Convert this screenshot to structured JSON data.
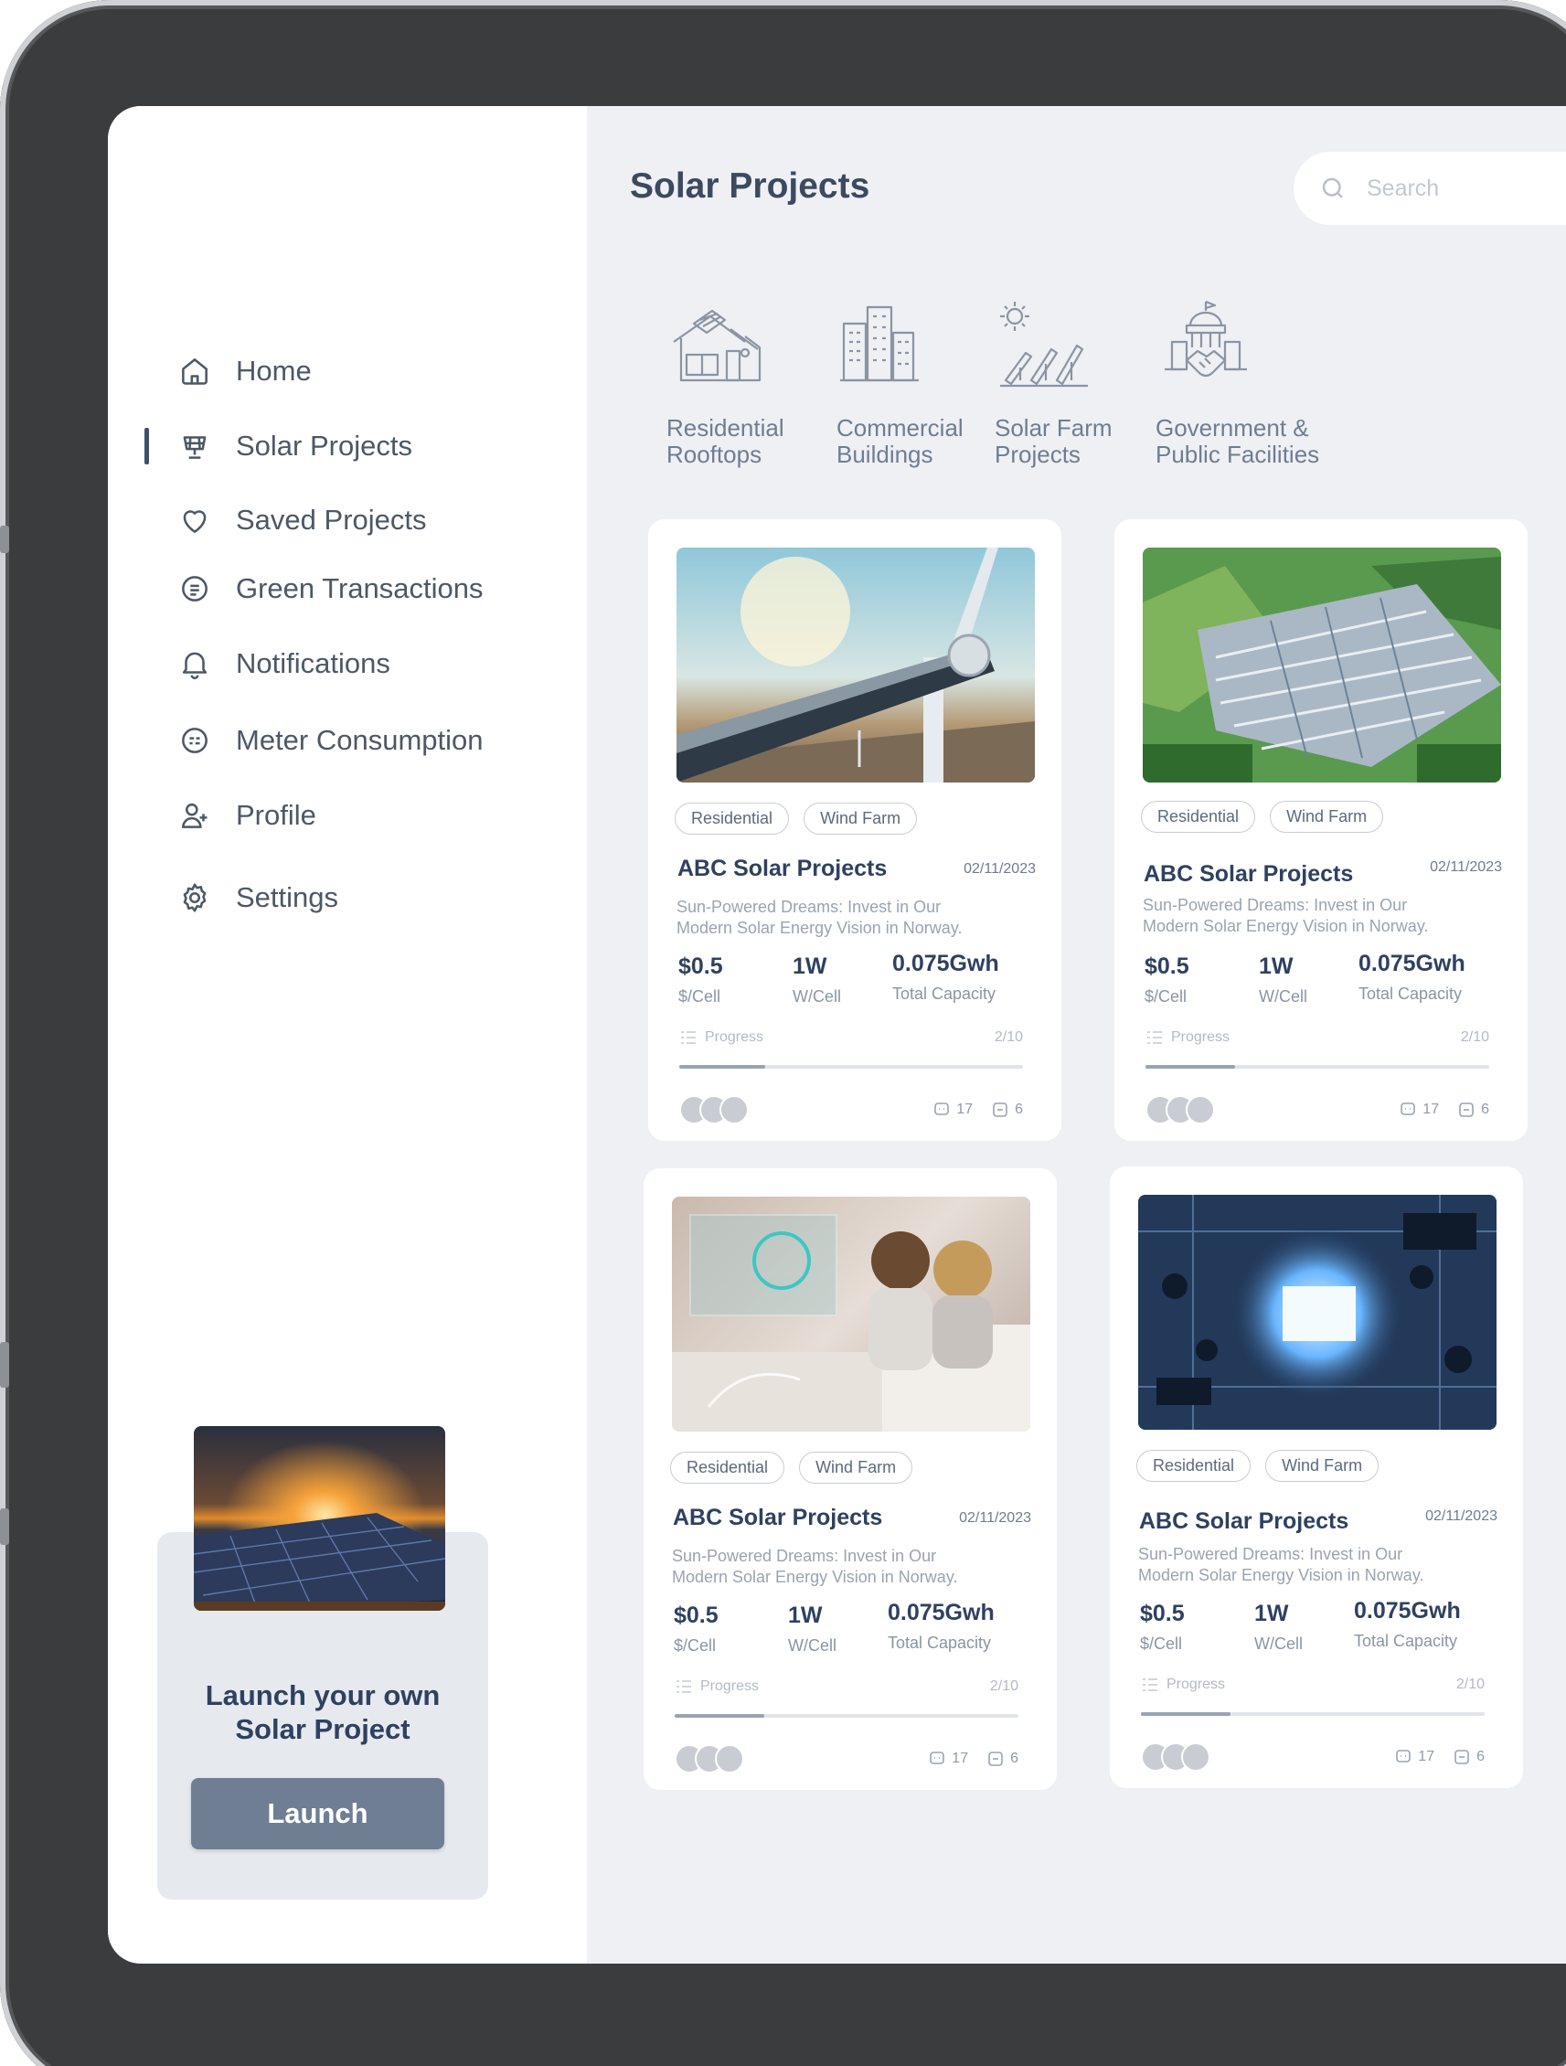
{
  "header": {
    "title": "Solar Projects",
    "search_placeholder": "Search"
  },
  "sidebar": {
    "items": [
      {
        "label": "Home",
        "icon": "home-icon"
      },
      {
        "label": "Solar Projects",
        "icon": "solar-panel-icon",
        "active": true
      },
      {
        "label": "Saved Projects",
        "icon": "heart-icon"
      },
      {
        "label": "Green Transactions",
        "icon": "receipt-icon"
      },
      {
        "label": "Notifications",
        "icon": "bell-icon"
      },
      {
        "label": "Meter Consumption",
        "icon": "meter-icon"
      },
      {
        "label": "Profile",
        "icon": "user-add-icon"
      },
      {
        "label": "Settings",
        "icon": "gear-icon"
      }
    ],
    "promo": {
      "title_line1": "Launch your own",
      "title_line2": "Solar Project",
      "button": "Launch"
    }
  },
  "categories": [
    {
      "line1": "Residential",
      "line2": "Rooftops",
      "icon": "house-solar-icon"
    },
    {
      "line1": "Commercial",
      "line2": "Buildings",
      "icon": "buildings-icon"
    },
    {
      "line1": "Solar Farm",
      "line2": "Projects",
      "icon": "solar-farm-icon"
    },
    {
      "line1": "Government &",
      "line2": "Public Facilities",
      "icon": "government-handshake-icon"
    }
  ],
  "cards": [
    {
      "image": "wind-turbine-image",
      "tags": [
        "Residential",
        "Wind Farm"
      ],
      "title": "ABC Solar Projects",
      "date": "02/11/2023",
      "desc1": "Sun-Powered Dreams: Invest in Our",
      "desc2": "Modern Solar Energy Vision in Norway.",
      "price": "$0.5",
      "price_unit": "$/Cell",
      "watt": "1W",
      "watt_unit": "W/Cell",
      "capacity": "0.075Gwh",
      "capacity_unit": "Total Capacity",
      "progress_label": "Progress",
      "progress_text": "2/10",
      "progress": 0.25,
      "comments": "17",
      "files": "6"
    },
    {
      "image": "solar-field-aerial-image",
      "tags": [
        "Residential",
        "Wind Farm"
      ],
      "title": "ABC Solar Projects",
      "date": "02/11/2023",
      "desc1": "Sun-Powered Dreams: Invest in Our",
      "desc2": "Modern Solar Energy Vision in Norway.",
      "price": "$0.5",
      "price_unit": "$/Cell",
      "watt": "1W",
      "watt_unit": "W/Cell",
      "capacity": "0.075Gwh",
      "capacity_unit": "Total Capacity",
      "progress_label": "Progress",
      "progress_text": "2/10",
      "progress": 0.26,
      "comments": "17",
      "files": "6"
    },
    {
      "image": "smart-home-couple-image",
      "tags": [
        "Residential",
        "Wind Farm"
      ],
      "title": "ABC Solar Projects",
      "date": "02/11/2023",
      "desc1": "Sun-Powered Dreams: Invest in Our",
      "desc2": "Modern Solar Energy Vision in Norway.",
      "price": "$0.5",
      "price_unit": "$/Cell",
      "watt": "1W",
      "watt_unit": "W/Cell",
      "capacity": "0.075Gwh",
      "capacity_unit": "Total Capacity",
      "progress_label": "Progress",
      "progress_text": "2/10",
      "progress": 0.26,
      "comments": "17",
      "files": "6"
    },
    {
      "image": "circuit-board-image",
      "tags": [
        "Residential",
        "Wind Farm"
      ],
      "title": "ABC Solar Projects",
      "date": "02/11/2023",
      "desc1": "Sun-Powered Dreams: Invest in Our",
      "desc2": "Modern Solar Energy Vision in Norway.",
      "price": "$0.5",
      "price_unit": "$/Cell",
      "watt": "1W",
      "watt_unit": "W/Cell",
      "capacity": "0.075Gwh",
      "capacity_unit": "Total Capacity",
      "progress_label": "Progress",
      "progress_text": "2/10",
      "progress": 0.26,
      "comments": "17",
      "files": "6"
    }
  ],
  "colors": {
    "accent": "#2f4160",
    "button": "#6f7e92",
    "frame": "#3b3c3e",
    "background": "#eef0f4"
  }
}
